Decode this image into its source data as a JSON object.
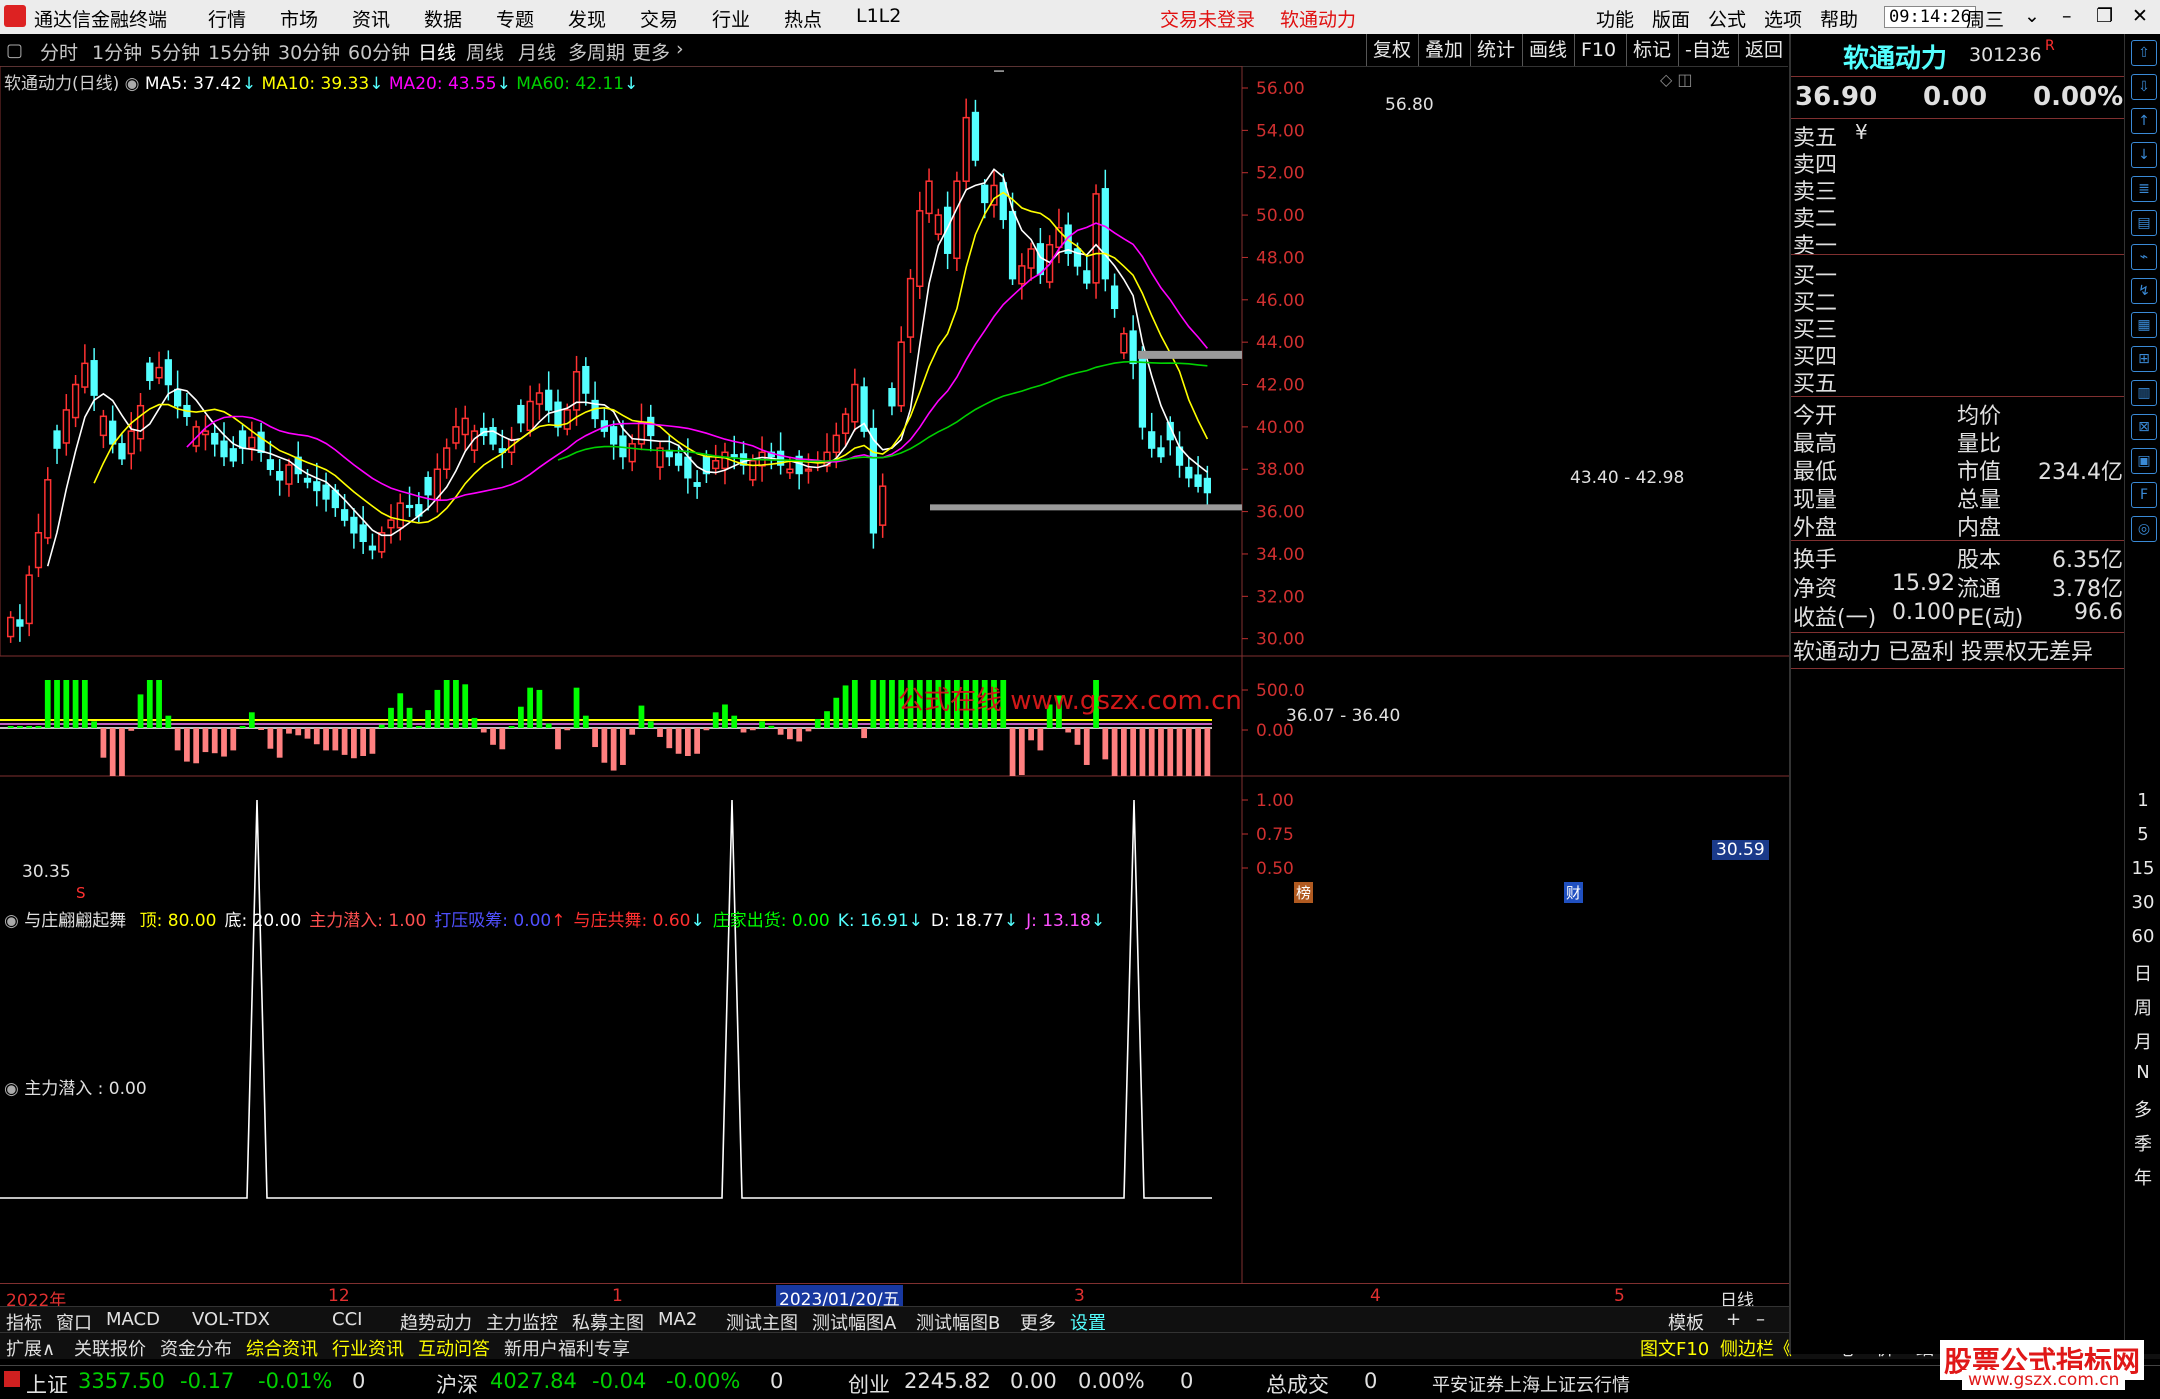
{
  "app": {
    "title": "通达信金融终端",
    "menu": [
      "行情",
      "市场",
      "资讯",
      "数据",
      "专题",
      "发现",
      "交易",
      "行业",
      "热点",
      "L1L2"
    ],
    "alert": "交易未登录",
    "alert_stock": "软通动力",
    "right_menu": [
      "功能",
      "版面",
      "公式",
      "选项",
      "帮助"
    ],
    "time": "09:14:26",
    "weekday": "周三",
    "window_buttons": [
      "⌄",
      "–",
      "❐",
      "✕"
    ]
  },
  "periods": {
    "items": [
      "分时",
      "1分钟",
      "5分钟",
      "15分钟",
      "30分钟",
      "60分钟",
      "日线",
      "周线",
      "月线",
      "多周期",
      "更多"
    ],
    "selected": "日线"
  },
  "toolbar_right": [
    "复权",
    "叠加",
    "统计",
    "画线",
    "F10",
    "标记",
    "-自选",
    "返回"
  ],
  "main_chart": {
    "legend": {
      "name": "软通动力(日线)",
      "ma5": "MA5: 37.42",
      "ma10": "MA10: 39.33",
      "ma20": "MA20: 43.55",
      "ma60": "MA60: 42.11"
    },
    "colors": {
      "up": "#ff3232",
      "down": "#54ffff",
      "ma5": "#ffffff",
      "ma10": "#ffff00",
      "ma20": "#ff00ff",
      "ma60": "#00d000"
    },
    "y_ticks": [
      "56.00",
      "54.00",
      "52.00",
      "50.00",
      "48.00",
      "46.00",
      "44.00",
      "42.00",
      "40.00",
      "38.00",
      "36.00",
      "34.00",
      "32.00",
      "30.00"
    ],
    "annotations": {
      "high": "56.80",
      "low": "30.35",
      "zone_top": "43.40 - 42.98",
      "zone_bottom": "36.07 - 36.40",
      "price_tag": "30.59",
      "watermark": "公式在线  www.gszx.com.cn",
      "marker_s": "S",
      "marker_bang": "榜",
      "marker_cai": "财"
    }
  },
  "indicator1": {
    "name": "与庄翩翩起舞",
    "items": [
      {
        "label": "顶: 80.00",
        "color": "#ffff00"
      },
      {
        "label": "底: 20.00",
        "color": "#ffffff"
      },
      {
        "label": "主力潜入: 1.00",
        "color": "#ff5050"
      },
      {
        "label": "打压吸筹: 0.00",
        "color": "#5050ff",
        "arrow": "↑",
        "arrow_color": "#ff3030"
      },
      {
        "label": "与庄共舞: 0.60",
        "color": "#ff3030",
        "arrow": "↓",
        "arrow_color": "#54ffff"
      },
      {
        "label": "庄家出货: 0.00",
        "color": "#00ff00"
      },
      {
        "label": "K: 16.91",
        "color": "#54ffff",
        "arrow": "↓",
        "arrow_color": "#54ffff"
      },
      {
        "label": "D: 18.77",
        "color": "#ffffff",
        "arrow": "↓",
        "arrow_color": "#54ffff"
      },
      {
        "label": "J: 13.18",
        "color": "#ff50ff",
        "arrow": "↓",
        "arrow_color": "#54ffff"
      }
    ],
    "y_ticks": [
      "500.0",
      "0.00"
    ]
  },
  "indicator2": {
    "name": "主力潜入 : 0.00",
    "y_ticks": [
      "1.00",
      "0.75",
      "0.50"
    ]
  },
  "date_axis": {
    "labels": [
      "2022年",
      "12",
      "1",
      "3",
      "4",
      "5"
    ],
    "cursor_date": "2023/01/20/五",
    "right_label": "日线"
  },
  "bottom_tabs": {
    "row1": [
      "指标",
      "窗口",
      "MACD",
      "VOL-TDX",
      "CCI",
      "趋势动力",
      "主力监控",
      "私募主图",
      "MA2",
      "测试主图",
      "测试幅图A",
      "测试幅图B",
      "更多",
      "设置"
    ],
    "row1_right": [
      "模板",
      "+",
      "–"
    ],
    "row2": [
      "扩展∧",
      "关联报价",
      "资金分布",
      "综合资讯",
      "行业资讯",
      "互动问答",
      "新用户福利专享"
    ],
    "row2_right": [
      "图文F10",
      "侧边栏《",
      "笔",
      "价",
      "细",
      "势"
    ]
  },
  "quote": {
    "name": "软通动力",
    "code": "301236",
    "badge": "R",
    "price": "36.90",
    "change": "0.00",
    "pct": "0.00%",
    "sell": [
      "卖五",
      "卖四",
      "卖三",
      "卖二",
      "卖一"
    ],
    "sell_unit": "¥",
    "buy": [
      "买一",
      "买二",
      "买三",
      "买四",
      "买五"
    ],
    "stats": [
      {
        "l": "今开",
        "v": "",
        "l2": "均价",
        "v2": ""
      },
      {
        "l": "最高",
        "v": "",
        "l2": "量比",
        "v2": ""
      },
      {
        "l": "最低",
        "v": "",
        "l2": "市值",
        "v2": "234.4亿"
      },
      {
        "l": "现量",
        "v": "",
        "l2": "总量",
        "v2": ""
      },
      {
        "l": "外盘",
        "v": "",
        "l2": "内盘",
        "v2": ""
      }
    ],
    "fin": [
      {
        "l": "换手",
        "v": "",
        "l2": "股本",
        "v2": "6.35亿"
      },
      {
        "l": "净资",
        "v": "15.92",
        "l2": "流通",
        "v2": "3.78亿"
      },
      {
        "l": "收益(一)",
        "v": "0.100",
        "l2": "PE(动)",
        "v2": "96.6"
      }
    ],
    "footer": "软通动力 已盈利 投票权无差异"
  },
  "side_strip": [
    "1",
    "5",
    "15",
    "30",
    "60",
    "日",
    "周",
    "月",
    "N",
    "多",
    "季",
    "年"
  ],
  "statusbar": {
    "items": [
      {
        "n": "上证",
        "p": "3357.50",
        "c": "-0.17",
        "pct": "-0.01%",
        "v": ""
      },
      {
        "n": "沪深",
        "p": "4027.84",
        "c": "-0.04",
        "pct": "-0.00%",
        "v": "0"
      },
      {
        "n": "创业",
        "p": "2245.82",
        "c": "0.00",
        "pct": "0.00%",
        "v": "0"
      }
    ],
    "total_label": "总成交",
    "total_val": "0",
    "broker": "平安证券上海上证云行情",
    "first_v": "0",
    "brand": "股票公式指标网",
    "brand_url": "www.gszx.com.cn"
  }
}
